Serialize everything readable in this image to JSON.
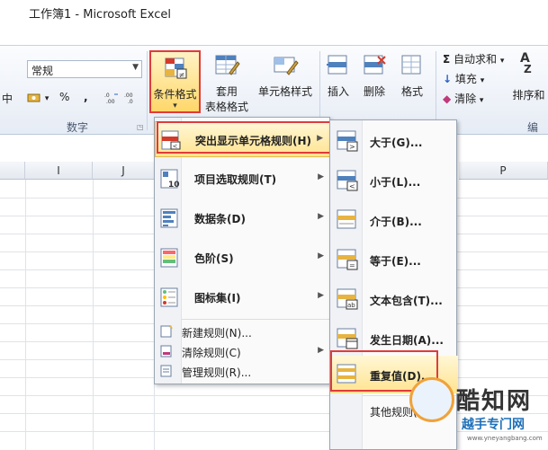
{
  "window": {
    "title": "工作簿1 - Microsoft Excel"
  },
  "ribbon": {
    "number_group": {
      "format_value": "常规",
      "percent": "%",
      "comma": ",",
      "label": "数字",
      "left_fragment": "中"
    },
    "styles": {
      "conditional_format": "条件格式",
      "table_format_line1": "套用",
      "table_format_line2": "表格格式",
      "cell_style": "单元格样式"
    },
    "cells": {
      "insert": "插入",
      "delete": "删除",
      "format": "格式"
    },
    "editing": {
      "autosum": "自动求和",
      "fill": "填充",
      "clear": "清除",
      "sort_fragment": "排序和",
      "label_fragment": "编辑"
    }
  },
  "sheet": {
    "columns": [
      "I",
      "J",
      "P"
    ]
  },
  "conditional_menu": {
    "items": [
      {
        "label": "突出显示单元格规则(H)"
      },
      {
        "label": "项目选取规则(T)"
      },
      {
        "label": "数据条(D)"
      },
      {
        "label": "色阶(S)"
      },
      {
        "label": "图标集(I)"
      }
    ],
    "small_items": [
      {
        "label": "新建规则(N)..."
      },
      {
        "label": "清除规则(C)"
      },
      {
        "label": "管理规则(R)..."
      }
    ]
  },
  "highlight_submenu": {
    "items": [
      {
        "label": "大于(G)..."
      },
      {
        "label": "小于(L)..."
      },
      {
        "label": "介于(B)..."
      },
      {
        "label": "等于(E)..."
      },
      {
        "label": "文本包含(T)..."
      },
      {
        "label": "发生日期(A)..."
      },
      {
        "label": "重复值(D)..."
      },
      {
        "label": "其他规则(M)..."
      }
    ]
  },
  "watermark": {
    "name": "酷知网",
    "sub": "越手专门网",
    "url": "www.yneyangbang.com"
  },
  "colors": {
    "highlight_red": "#e03b3b",
    "hover_gold": "#ffe38f",
    "ribbon_bg": "#e6ecf5"
  }
}
